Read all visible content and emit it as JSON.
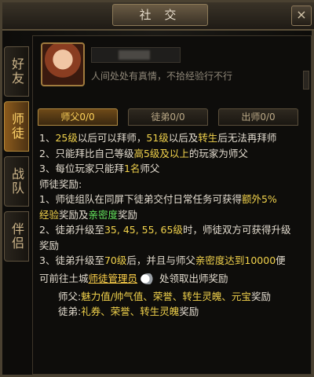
{
  "window": {
    "title": "社 交",
    "close_glyph": "×"
  },
  "side_tabs": [
    {
      "label": "好友",
      "active": false
    },
    {
      "label": "师徒",
      "active": true
    },
    {
      "label": "战队",
      "active": false
    },
    {
      "label": "伴侣",
      "active": false
    }
  ],
  "profile": {
    "signature": "人间处处有真情，不拾经验行不行"
  },
  "sub_tabs": [
    {
      "label": "师父0/0",
      "active": true
    },
    {
      "label": "徒弟0/0",
      "active": false
    },
    {
      "label": "出师0/0",
      "active": false
    }
  ],
  "rules": {
    "r1_a": "1、",
    "r1_b": "25级",
    "r1_c": "以后可以拜师，",
    "r1_d": "51级",
    "r1_e": "以后及",
    "r1_f": "转生",
    "r1_g": "后无法再拜师",
    "r2_a": "2、只能拜比自己等级",
    "r2_b": "高5级及以上",
    "r2_c": "的玩家为师父",
    "r3_a": "3、每位玩家只能拜",
    "r3_b": "1名",
    "r3_c": "师父",
    "reward_title": "师徒奖励:",
    "w1_a": "1、师徒组队在同屏下徒弟交付日常任务可获得",
    "w1_b": "额外5%",
    "w1_c": "经验",
    "w1_d": "奖励及",
    "w1_e": "亲密度",
    "w1_f": "奖励",
    "w2_a": "2、徒弟升级至",
    "w2_b": "35, 45, 55, 65级",
    "w2_c": "时，师徒双方可获得升级",
    "w2_d": "奖励",
    "w3_a": "3、徒弟升级至",
    "w3_b": "70级",
    "w3_c": "后，并且与师父",
    "w3_d": "亲密度达到10000",
    "w3_e": "便",
    "w3_f": "可前往土城",
    "w3_g": "师徒管理员",
    "w3_h": "处领取出师奖励",
    "m_a": "师父:",
    "m_b": "魅力值/帅气值、荣誉、转生灵魄、元宝",
    "m_c": "奖励",
    "s_a": "徒弟:",
    "s_b": "礼券、荣誉、转生灵魄",
    "s_c": "奖励"
  },
  "colors": {
    "highlight_yellow": "#f2d34c",
    "highlight_green": "#63e05c",
    "active_tab": "#ffd36a"
  },
  "icons": {
    "npc_link": "white-wing-icon"
  }
}
